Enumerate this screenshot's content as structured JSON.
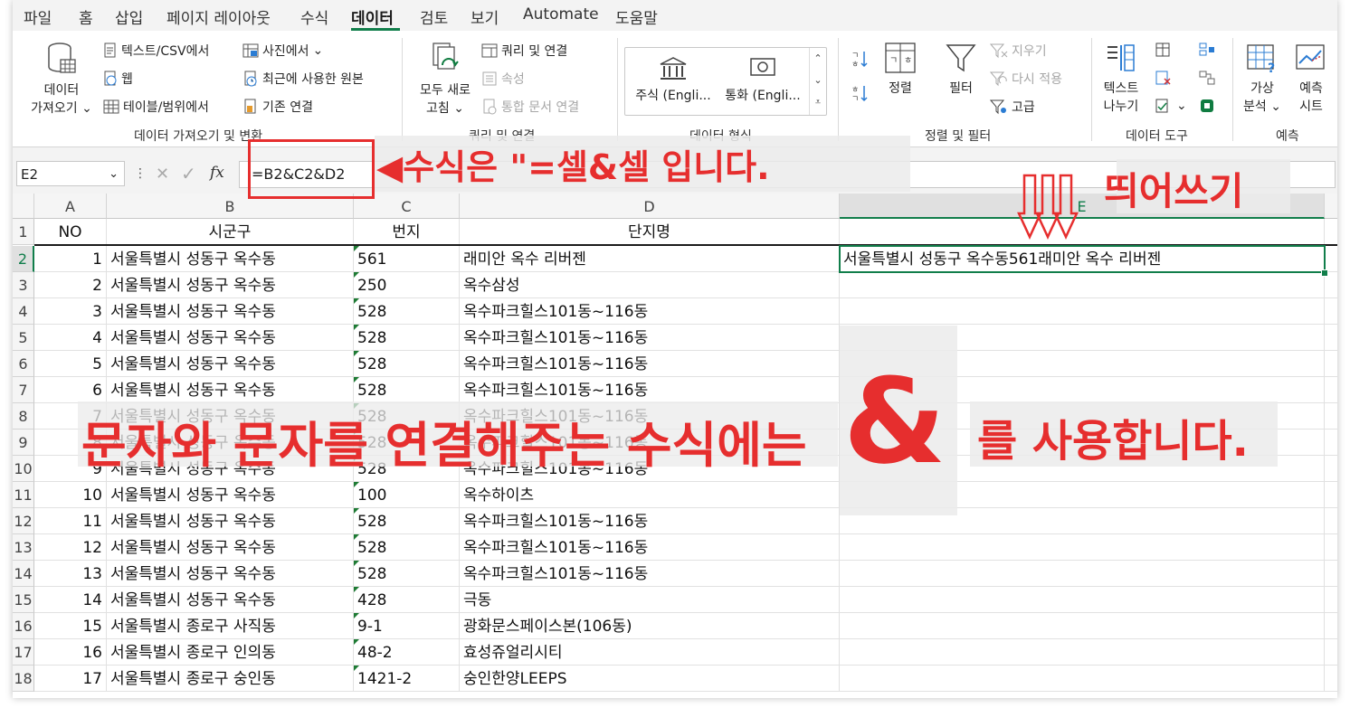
{
  "tabs": [
    "파일",
    "홈",
    "삽입",
    "페이지 레이아웃",
    "수식",
    "데이터",
    "검토",
    "보기",
    "Automate",
    "도움말"
  ],
  "ribbon": {
    "get_data": {
      "label_line1": "데이터",
      "label_line2": "가져오기"
    },
    "text_csv": "텍스트/CSV에서",
    "web": "웹",
    "table_range": "테이블/범위에서",
    "from_picture": "사진에서",
    "recent_sources": "최근에 사용한 원본",
    "existing_connections": "기존 연결",
    "group_get_transform": "데이터 가져오기 및 변환",
    "refresh_all": {
      "line1": "모두 새로",
      "line2": "고침"
    },
    "queries_connections": "쿼리 및 연결",
    "properties": "속성",
    "edit_links": "통합 문서 연결",
    "group_queries": "쿼리 및 연결",
    "stocks": "주식 (Engli...",
    "currencies": "통화 (Engli...",
    "group_data_types": "데이터 형식",
    "sort": "정렬",
    "filter": "필터",
    "clear": "지우기",
    "reapply": "다시 적용",
    "advanced": "고급",
    "group_sort_filter": "정렬 및 필터",
    "text_to_columns": {
      "line1": "텍스트",
      "line2": "나누기"
    },
    "group_data_tools": "데이터 도구",
    "whatif": {
      "line1": "가상",
      "line2": "분석"
    },
    "forecast_sheet": {
      "line1": "예측",
      "line2": "시트"
    },
    "group_forecast": "예측"
  },
  "formula_bar": {
    "name_box": "E2",
    "fx": "fx",
    "formula": "=B2&C2&D2"
  },
  "columns": [
    "A",
    "B",
    "C",
    "D",
    "E"
  ],
  "header_row": {
    "a": "NO",
    "b": "시군구",
    "c": "번지",
    "d": "단지명"
  },
  "rows": [
    {
      "rn": "2",
      "no": "1",
      "b": "서울특별시 성동구 옥수동",
      "c": "561",
      "d": "래미안 옥수 리버젠",
      "e": "서울특별시 성동구 옥수동561래미안 옥수 리버젠"
    },
    {
      "rn": "3",
      "no": "2",
      "b": "서울특별시 성동구 옥수동",
      "c": "250",
      "d": "옥수삼성",
      "e": ""
    },
    {
      "rn": "4",
      "no": "3",
      "b": "서울특별시 성동구 옥수동",
      "c": "528",
      "d": "옥수파크힐스101동~116동",
      "e": ""
    },
    {
      "rn": "5",
      "no": "4",
      "b": "서울특별시 성동구 옥수동",
      "c": "528",
      "d": "옥수파크힐스101동~116동",
      "e": ""
    },
    {
      "rn": "6",
      "no": "5",
      "b": "서울특별시 성동구 옥수동",
      "c": "528",
      "d": "옥수파크힐스101동~116동",
      "e": ""
    },
    {
      "rn": "7",
      "no": "6",
      "b": "서울특별시 성동구 옥수동",
      "c": "528",
      "d": "옥수파크힐스101동~116동",
      "e": ""
    },
    {
      "rn": "8",
      "no": "7",
      "b": "서울특별시 성동구 옥수동",
      "c": "528",
      "d": "옥수파크힐스101동~116동",
      "e": ""
    },
    {
      "rn": "9",
      "no": "8",
      "b": "서울특별시 성동구 옥수동",
      "c": "528",
      "d": "옥수파크힐스101동~116동",
      "e": ""
    },
    {
      "rn": "10",
      "no": "9",
      "b": "서울특별시 성동구 옥수동",
      "c": "528",
      "d": "옥수파크힐스101동~116동",
      "e": ""
    },
    {
      "rn": "11",
      "no": "10",
      "b": "서울특별시 성동구 옥수동",
      "c": "100",
      "d": "옥수하이츠",
      "e": ""
    },
    {
      "rn": "12",
      "no": "11",
      "b": "서울특별시 성동구 옥수동",
      "c": "528",
      "d": "옥수파크힐스101동~116동",
      "e": ""
    },
    {
      "rn": "13",
      "no": "12",
      "b": "서울특별시 성동구 옥수동",
      "c": "528",
      "d": "옥수파크힐스101동~116동",
      "e": ""
    },
    {
      "rn": "14",
      "no": "13",
      "b": "서울특별시 성동구 옥수동",
      "c": "528",
      "d": "옥수파크힐스101동~116동",
      "e": ""
    },
    {
      "rn": "15",
      "no": "14",
      "b": "서울특별시 성동구 옥수동",
      "c": "428",
      "d": "극동",
      "e": ""
    },
    {
      "rn": "16",
      "no": "15",
      "b": "서울특별시 종로구 사직동",
      "c": "9-1",
      "d": "광화문스페이스본(106동)",
      "e": ""
    },
    {
      "rn": "17",
      "no": "16",
      "b": "서울특별시 종로구 인의동",
      "c": "48-2",
      "d": "효성쥬얼리시티",
      "e": ""
    },
    {
      "rn": "18",
      "no": "17",
      "b": "서울특별시 종로구 숭인동",
      "c": "1421-2",
      "d": "숭인한양LEEPS",
      "e": ""
    }
  ],
  "annotations": {
    "formula_note": "◀수식은 \"=셀&셀 입니다.",
    "spacing_note": "띄어쓰기",
    "main_note_left": "문자와 문자를 연결해주는 수식에는",
    "ampersand": "&",
    "main_note_right": "를 사용합니다.",
    "color": "#e62e2e"
  }
}
